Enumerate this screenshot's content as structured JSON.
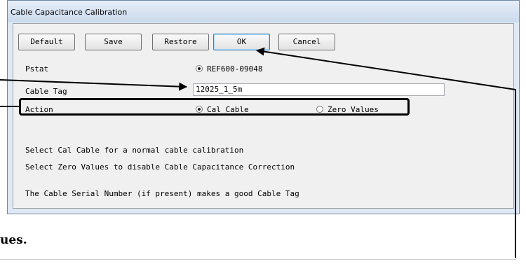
{
  "window": {
    "title": "Cable Capacitance Calibration"
  },
  "buttons": {
    "default": "Default",
    "save": "Save",
    "restore": "Restore",
    "ok": "OK",
    "cancel": "Cancel"
  },
  "form": {
    "pstat_label": "Pstat",
    "pstat_option": "REF600-09048",
    "cable_tag_label": "Cable Tag",
    "cable_tag_value": "12025_1_5m",
    "action_label": "Action",
    "action_options": {
      "cal_cable": "Cal Cable",
      "zero_values": "Zero Values"
    },
    "action_selected": "Cal Cable"
  },
  "help": {
    "line1": "Select Cal Cable for a normal cable calibration",
    "line2": "Select Zero Values to disable Cable Capacitance Correction",
    "line3": "The Cable Serial Number (if present) makes a good Cable Tag"
  },
  "page_text": {
    "bottom_fragment": "ues."
  }
}
